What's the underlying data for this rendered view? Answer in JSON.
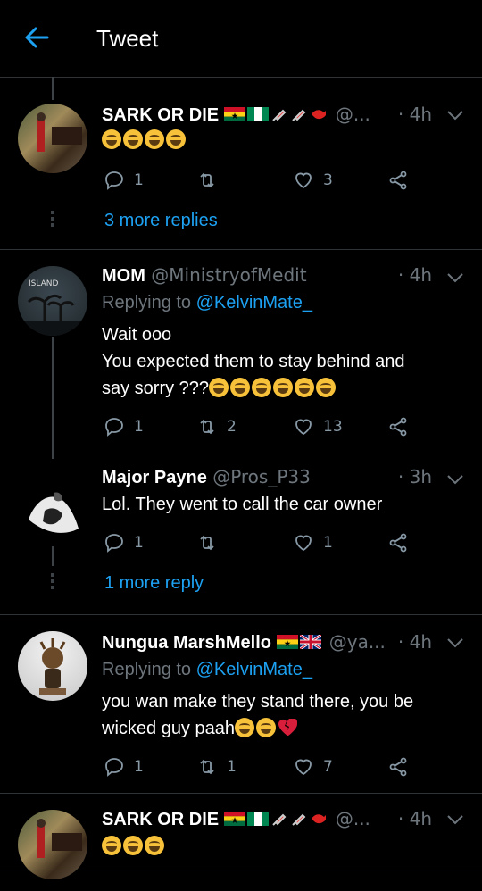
{
  "header": {
    "title": "Tweet"
  },
  "tweets": [
    {
      "name": "SARK OR DIE",
      "handle": "@...",
      "time": "· 4h",
      "replying_to": null,
      "text_lines": [],
      "emoji_count": 4,
      "replies": "1",
      "retweets": "",
      "likes": "3",
      "more_replies": "3 more replies"
    },
    {
      "name": "MOM",
      "handle": "@MinistryofMedit",
      "time": "· 4h",
      "replying_label": "Replying to",
      "replying_handle": "@KelvinMate_",
      "text_line1": "Wait ooo",
      "text_line2": "You expected them to stay behind and",
      "text_line3": "say sorry ???",
      "replies": "1",
      "retweets": "2",
      "likes": "13"
    },
    {
      "name": "Major Payne",
      "handle": "@Pros_P33",
      "time": "· 3h",
      "text_line1": "Lol. They went to call the car owner",
      "replies": "1",
      "retweets": "",
      "likes": "1",
      "more_replies": "1 more reply"
    },
    {
      "name": "Nungua MarshMello",
      "handle": "@ya...",
      "time": "· 4h",
      "replying_label": "Replying to",
      "replying_handle": "@KelvinMate_",
      "text_line1": "you wan make they stand there, you be",
      "text_line2": "wicked guy paah",
      "replies": "1",
      "retweets": "1",
      "likes": "7"
    },
    {
      "name": "SARK OR DIE",
      "handle": "@...",
      "time": "· 4h"
    }
  ],
  "icons": {
    "back": "arrow-left-icon",
    "reply": "comment-icon",
    "retweet": "retweet-icon",
    "like": "heart-icon",
    "share": "share-icon",
    "menu": "chevron-down-icon"
  },
  "colors": {
    "accent": "#1da1f2",
    "bg": "#000000",
    "muted": "#8899a6"
  }
}
